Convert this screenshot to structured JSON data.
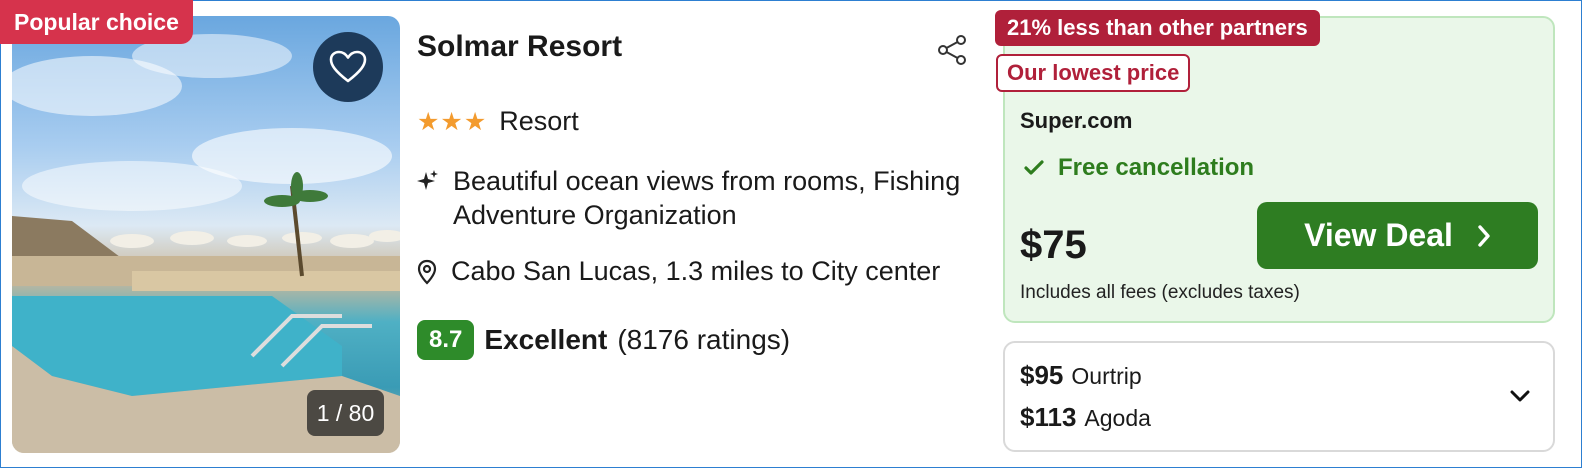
{
  "listing": {
    "popular_badge": "Popular choice",
    "image_counter": "1 / 80",
    "title": "Solmar Resort",
    "stars_text": "★★★",
    "type": "Resort",
    "features": "Beautiful ocean views from rooms, Fishing Adventure Organization",
    "location": "Cabo San Lucas, 1.3 miles to City center",
    "rating": {
      "score": "8.7",
      "label": "Excellent",
      "count": "(8176 ratings)"
    }
  },
  "deal": {
    "tag_savings": "21% less than other partners",
    "tag_lowest": "Our lowest price",
    "partner": "Super.com",
    "free_cancellation": "Free cancellation",
    "price": "$75",
    "button_label": "View Deal",
    "fees_note": "Includes all fees (excludes taxes)"
  },
  "other_prices": [
    {
      "price": "$95",
      "partner": "Ourtrip"
    },
    {
      "price": "$113",
      "partner": "Agoda"
    }
  ],
  "colors": {
    "accent_green": "#2e7d22",
    "badge_red": "#d6334c",
    "tag_red": "#b0203a",
    "star_orange": "#f39b2e"
  },
  "icons": [
    "heart-icon",
    "share-icon",
    "sparkle-icon",
    "location-pin-icon",
    "check-icon",
    "chevron-right-icon",
    "chevron-down-icon"
  ]
}
